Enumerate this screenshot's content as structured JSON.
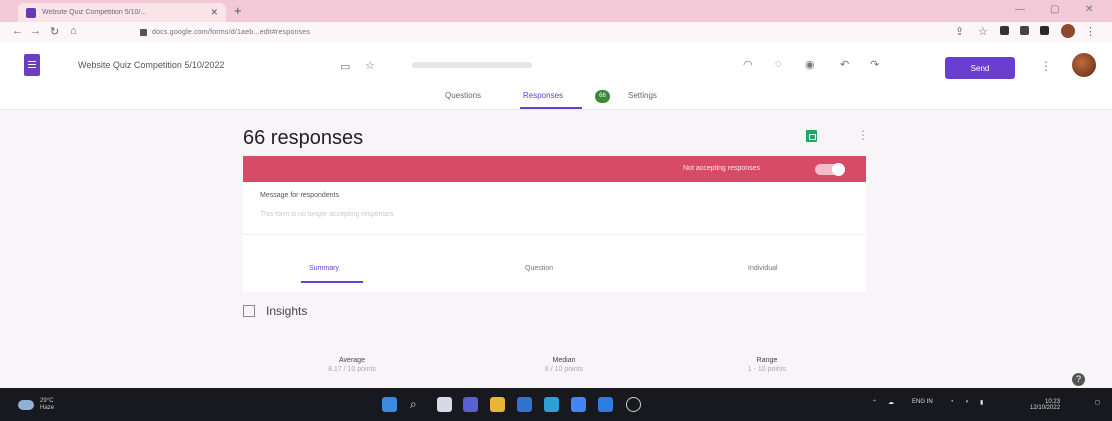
{
  "browser": {
    "tab_title": "Website Quiz Competition 5/10/...",
    "tab_close": "✕",
    "new_tab": "+",
    "url": "docs.google.com/forms/d/1aeb...edit#responses"
  },
  "forms_header": {
    "doc_title": "Website Quiz Competition 5/10/2022",
    "send_label": "Send"
  },
  "form_tabs": {
    "questions": "Questions",
    "responses": "Responses",
    "responses_count": "66",
    "settings": "Settings"
  },
  "main": {
    "responses_title": "66 responses",
    "banner_text": "Not accepting responses",
    "message_label": "Message for respondents",
    "message_placeholder": "This form is no longer accepting responses"
  },
  "summary_tabs": {
    "summary": "Summary",
    "question": "Question",
    "individual": "Individual"
  },
  "insights": {
    "title": "Insights",
    "stats": [
      {
        "label": "Average",
        "value": "8.17 / 10 points"
      },
      {
        "label": "Median",
        "value": "8 / 10 points"
      },
      {
        "label": "Range",
        "value": "1 - 10 points"
      }
    ]
  },
  "taskbar": {
    "weather_temp": "29°C",
    "weather_desc": "Haze",
    "lang": "ENG IN",
    "time": "10:23",
    "date": "12/10/2022"
  },
  "colors": {
    "accent": "#6a3fd0",
    "banner": "#d84b66",
    "sheets": "#23a566"
  }
}
